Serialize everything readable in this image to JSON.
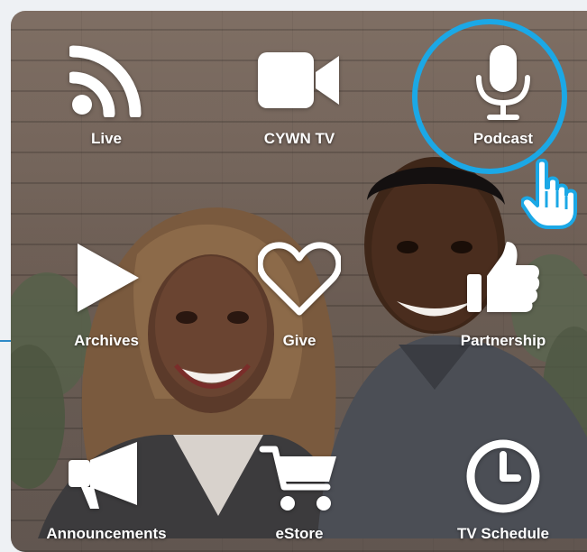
{
  "menu": {
    "items": [
      {
        "label": "Live",
        "icon": "rss-icon"
      },
      {
        "label": "CYWN TV",
        "icon": "video-camera-icon"
      },
      {
        "label": "Podcast",
        "icon": "microphone-icon"
      },
      {
        "label": "Archives",
        "icon": "play-icon"
      },
      {
        "label": "Give",
        "icon": "heart-icon"
      },
      {
        "label": "Partnership",
        "icon": "thumbs-up-icon"
      },
      {
        "label": "Announcements",
        "icon": "megaphone-icon"
      },
      {
        "label": "eStore",
        "icon": "shopping-cart-icon"
      },
      {
        "label": "TV Schedule",
        "icon": "clock-icon"
      }
    ]
  },
  "highlight": {
    "target": "Podcast",
    "color": "#1ba8e6"
  },
  "colors": {
    "label_text": "#ffffff",
    "accent": "#1ba8e6"
  }
}
